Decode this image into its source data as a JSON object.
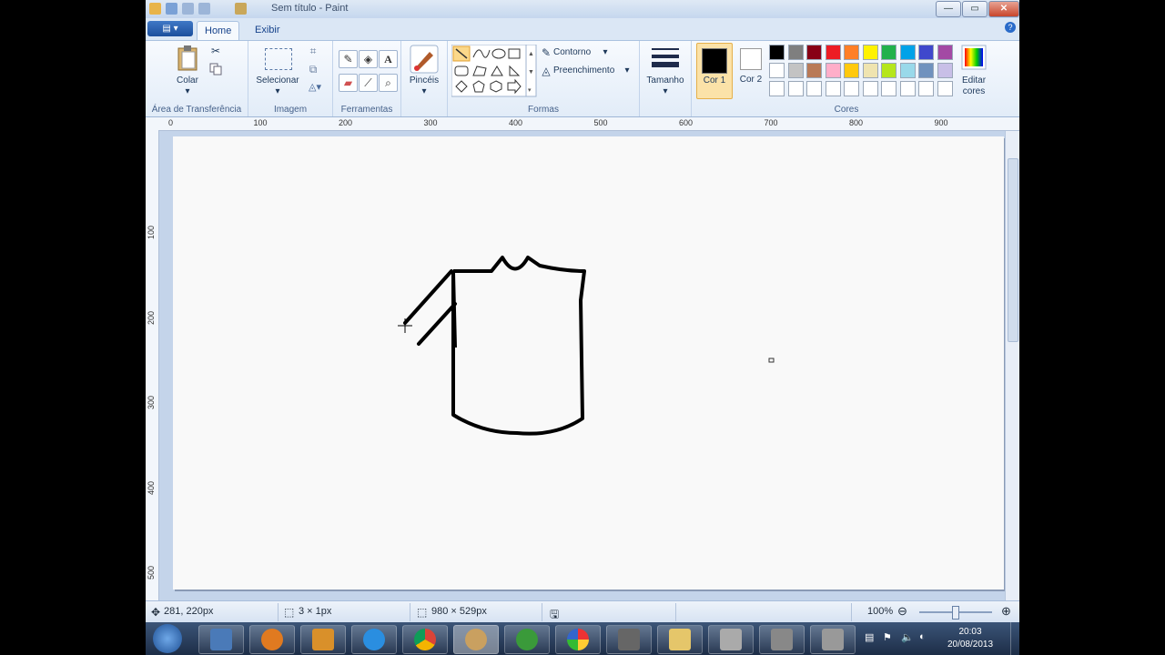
{
  "window": {
    "title": "Sem título - Paint"
  },
  "tabs": {
    "home": "Home",
    "view": "Exibir"
  },
  "menu_button": "▤ ▾",
  "window_controls": {
    "minimize": "—",
    "maximize": "▭",
    "close": "✕"
  },
  "help": "?",
  "ribbon": {
    "clipboard": {
      "label": "Área de Transferência",
      "paste": "Colar"
    },
    "image": {
      "label": "Imagem",
      "select": "Selecionar"
    },
    "tools": {
      "label": "Ferramentas"
    },
    "brushes": {
      "label": "Pincéis"
    },
    "shapes": {
      "label": "Formas",
      "outline": "Contorno",
      "fill": "Preenchimento"
    },
    "size": {
      "label": "Tamanho"
    },
    "colors": {
      "label": "Cores",
      "color1": "Cor 1",
      "color2": "Cor 2",
      "edit": "Editar cores",
      "color1_value": "#000000",
      "color2_value": "#ffffff",
      "palette_row1": [
        "#000000",
        "#7f7f7f",
        "#880015",
        "#ed1c24",
        "#ff7f27",
        "#fff200",
        "#22b14c",
        "#00a2e8",
        "#3f48cc",
        "#a349a4"
      ],
      "palette_row2": [
        "#ffffff",
        "#c3c3c3",
        "#b97a57",
        "#ffaec9",
        "#ffc90e",
        "#efe4b0",
        "#b5e61d",
        "#99d9ea",
        "#7092be",
        "#c8bfe7"
      ]
    }
  },
  "ruler": {
    "h": [
      "0",
      "100",
      "200",
      "300",
      "400",
      "500",
      "600",
      "700",
      "800",
      "900"
    ],
    "v": [
      "100",
      "200",
      "300",
      "400",
      "500"
    ]
  },
  "status": {
    "cursor": "281, 220px",
    "selection": "3 × 1px",
    "image_size": "980 × 529px",
    "zoom": "100%"
  },
  "taskbar": {
    "time": "20:03",
    "date": "20/08/2013"
  }
}
